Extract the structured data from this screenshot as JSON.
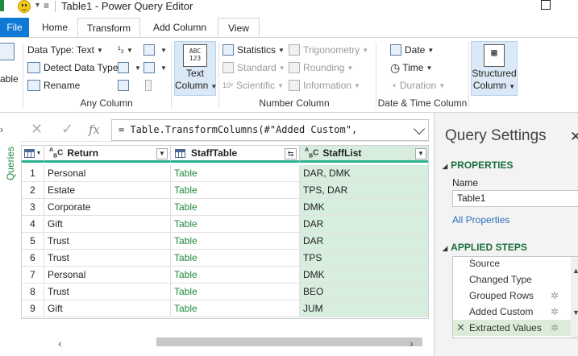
{
  "window": {
    "title": "Table1 - Power Query Editor"
  },
  "tabs": [
    {
      "label": "File"
    },
    {
      "label": "Home"
    },
    {
      "label": "Transform"
    },
    {
      "label": "Add Column"
    },
    {
      "label": "View"
    }
  ],
  "ribbon": {
    "left_partial_label": "able",
    "any_column": {
      "data_type": "Data Type: Text",
      "detect_data_type": "Detect Data Type",
      "rename": "Rename",
      "group_label": "Any Column"
    },
    "text_column": {
      "icon_text": "ABC 123",
      "label_line1": "Text",
      "label_line2": "Column"
    },
    "number_column": {
      "statistics": "Statistics",
      "standard": "Standard",
      "scientific": "Scientific",
      "trigonometry": "Trigonometry",
      "rounding": "Rounding",
      "information": "Information",
      "group_label": "Number Column"
    },
    "date_time_column": {
      "date": "Date",
      "time": "Time",
      "duration": "Duration",
      "group_label": "Date & Time Column"
    },
    "structured_column": {
      "label_line1": "Structured",
      "label_line2": "Column"
    }
  },
  "queries_pane": {
    "label": "Queries"
  },
  "formula_bar": {
    "text": "= Table.TransformColumns(#\"Added Custom\","
  },
  "grid": {
    "columns": [
      {
        "type_icon": "ABC",
        "name": "Return"
      },
      {
        "type_icon": "table",
        "name": "StaffTable"
      },
      {
        "type_icon": "ABC",
        "name": "StaffList"
      }
    ],
    "rows": [
      {
        "n": "1",
        "return": "Personal",
        "staff_table": "Table",
        "staff_list": "DAR, DMK"
      },
      {
        "n": "2",
        "return": "Estate",
        "staff_table": "Table",
        "staff_list": "TPS, DAR"
      },
      {
        "n": "3",
        "return": "Corporate",
        "staff_table": "Table",
        "staff_list": "DMK"
      },
      {
        "n": "4",
        "return": "Gift",
        "staff_table": "Table",
        "staff_list": "DAR"
      },
      {
        "n": "5",
        "return": "Trust",
        "staff_table": "Table",
        "staff_list": "DAR"
      },
      {
        "n": "6",
        "return": "Trust",
        "staff_table": "Table",
        "staff_list": "TPS"
      },
      {
        "n": "7",
        "return": "Personal",
        "staff_table": "Table",
        "staff_list": "DMK"
      },
      {
        "n": "8",
        "return": "Trust",
        "staff_table": "Table",
        "staff_list": "BEO"
      },
      {
        "n": "9",
        "return": "Gift",
        "staff_table": "Table",
        "staff_list": "JUM"
      }
    ]
  },
  "query_settings": {
    "title": "Query Settings",
    "properties_header": "PROPERTIES",
    "name_label": "Name",
    "name_value": "Table1",
    "all_properties_link": "All Properties",
    "applied_steps_header": "APPLIED STEPS",
    "steps": [
      {
        "label": "Source",
        "has_gear": false,
        "current": false
      },
      {
        "label": "Changed Type",
        "has_gear": false,
        "current": false
      },
      {
        "label": "Grouped Rows",
        "has_gear": true,
        "current": false
      },
      {
        "label": "Added Custom",
        "has_gear": true,
        "current": false
      },
      {
        "label": "Extracted Values",
        "has_gear": true,
        "current": true
      }
    ]
  },
  "colors": {
    "file_tab": "#0f7ad6",
    "column_quality_bar": "#2bb38f",
    "selected_column": "#d7eedf",
    "table_link": "#1f8a3e",
    "section_header": "#1b6e3d"
  }
}
